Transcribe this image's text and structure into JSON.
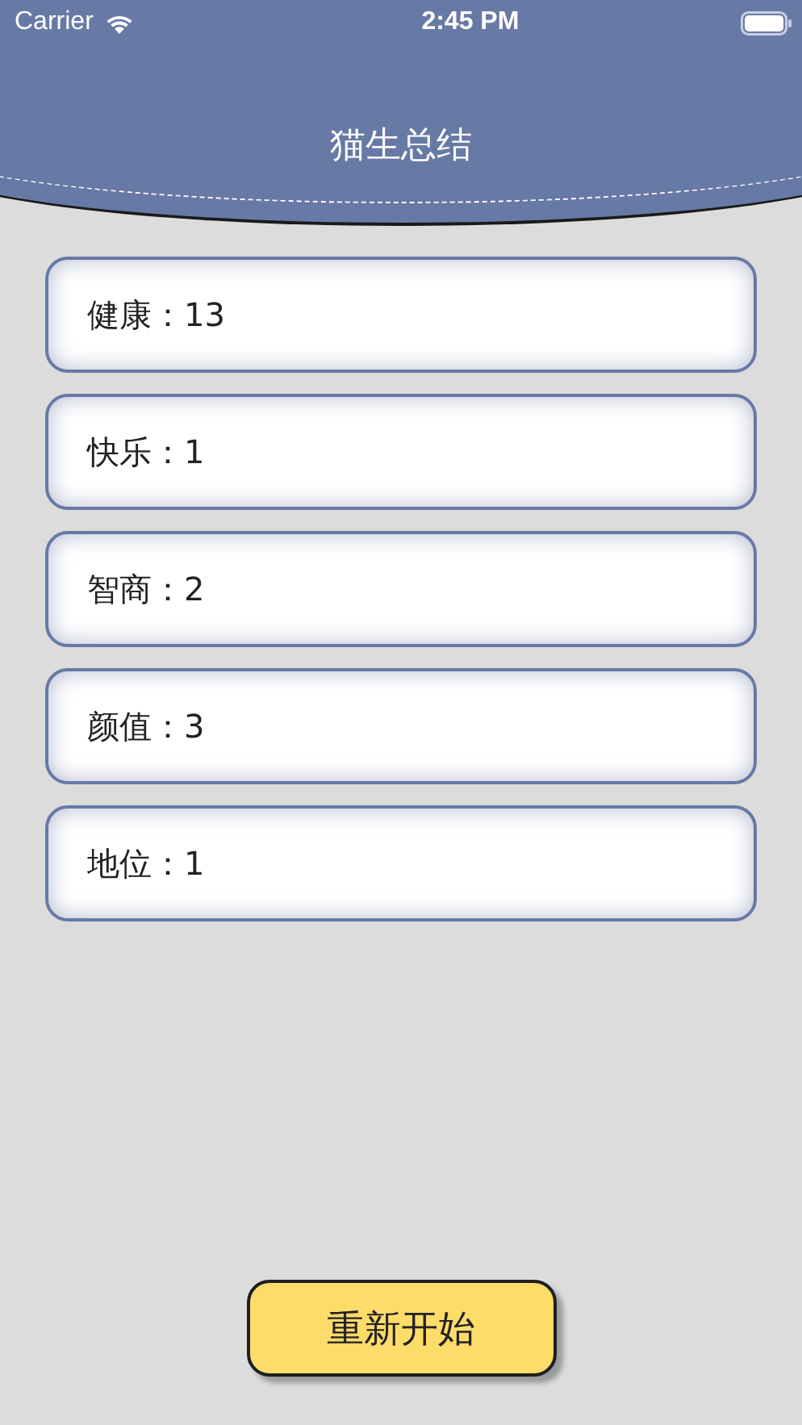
{
  "status_bar": {
    "carrier": "Carrier",
    "time": "2:45 PM"
  },
  "header": {
    "title": "猫生总结"
  },
  "stats": [
    {
      "text": "健康：13"
    },
    {
      "text": "快乐：1"
    },
    {
      "text": "智商：2"
    },
    {
      "text": "颜值：3"
    },
    {
      "text": "地位：1"
    }
  ],
  "button": {
    "label": "重新开始"
  }
}
